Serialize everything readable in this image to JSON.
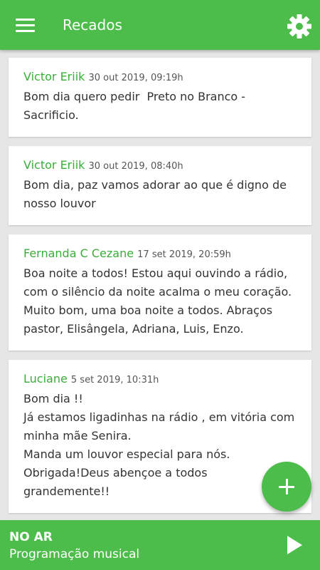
{
  "appbar": {
    "title": "Recados",
    "menu_icon": "hamburger-menu-icon",
    "settings_icon": "gear-icon",
    "color": "#4cbd4a"
  },
  "messages": [
    {
      "author": "Victor Eriik",
      "date": "30 out 2019, 09:19h",
      "text": "Bom dia quero pedir  Preto no Branco -\nSacrificio."
    },
    {
      "author": "Victor Eriik",
      "date": "30 out 2019, 08:40h",
      "text": "Bom dia, paz vamos adorar ao que é digno de\nnosso louvor"
    },
    {
      "author": "Fernanda C Cezane",
      "date": "17 set 2019, 20:59h",
      "text": "Boa noite a todos! Estou aqui ouvindo a rádio,\ncom o silêncio da noite acalma o meu coração.\nMuito bom, uma boa noite a todos. Abraços\npastor, Elisângela, Adriana, Luis, Enzo."
    },
    {
      "author": "Luciane",
      "date": "5 set 2019, 10:31h",
      "text": "Bom dia !!\nJá estamos ligadinhas na rádio , em vitória com\nminha mãe Senira.\nManda um louvor especial para nós.\nObrigada!Deus abençoe a todos\ngrandemente!!"
    }
  ],
  "fab": {
    "icon": "plus-icon"
  },
  "player": {
    "status": "NO AR",
    "program": "Programação musical",
    "play_icon": "play-icon"
  }
}
